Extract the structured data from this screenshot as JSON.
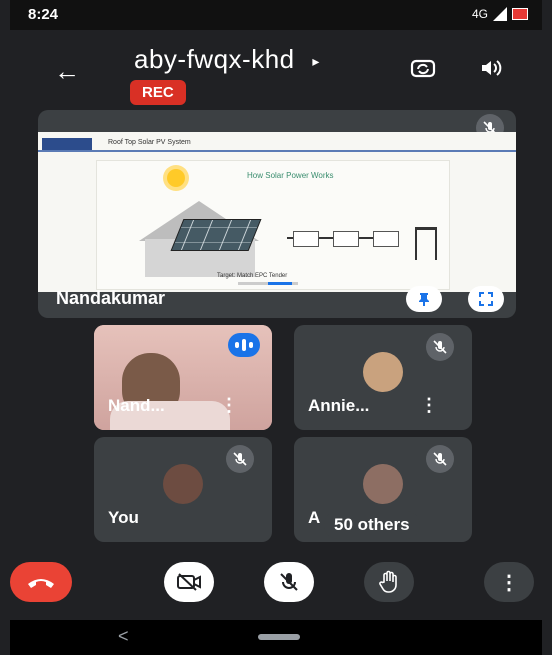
{
  "status": {
    "time": "8:24",
    "network": "4G"
  },
  "header": {
    "title": "aby-fwqx-khd",
    "caret": "▸",
    "rec_label": "REC",
    "back": "←"
  },
  "presentation": {
    "presenter_name": "Nandakumar",
    "slide": {
      "title": "Roof Top Solar PV System",
      "diagram_title": "How Solar Power Works",
      "diagram_caption": "Target: Match EPC Tender"
    }
  },
  "participants": [
    {
      "name": "Nand...",
      "speaking": true,
      "muted": false
    },
    {
      "name": "Annie...",
      "speaking": false,
      "muted": true
    },
    {
      "name": "You",
      "speaking": false,
      "muted": true
    },
    {
      "name": "50 others",
      "prefix": "A",
      "muted": true
    }
  ],
  "controls": [
    "end-call",
    "camera-off",
    "mic-off",
    "raise-hand",
    "more-options"
  ],
  "colors": {
    "background": "#202124",
    "tile": "#3c4043",
    "rec": "#d93025",
    "accent": "#1a73e8",
    "hangup": "#ea4335"
  }
}
